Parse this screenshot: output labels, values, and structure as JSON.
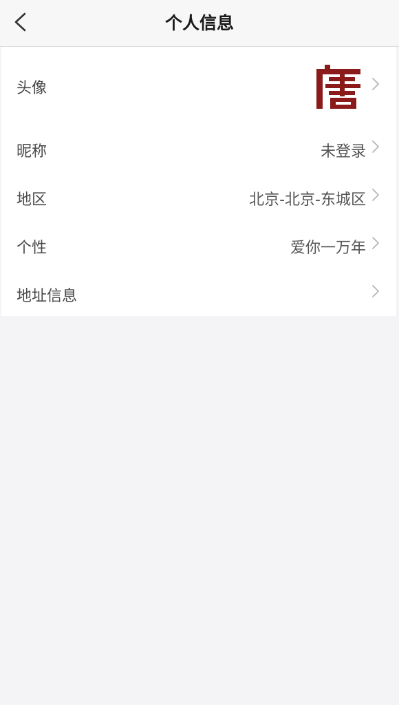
{
  "navbar": {
    "back_icon": "chevron-left-icon",
    "title": "个人信息"
  },
  "rows": [
    {
      "label": "头像",
      "value": "",
      "type": "avatar"
    },
    {
      "label": "昵称",
      "value": "未登录"
    },
    {
      "label": "地区",
      "value": "北京-北京-东城区"
    },
    {
      "label": "个性",
      "value": "爱你一万年"
    },
    {
      "label": "地址信息",
      "value": ""
    }
  ],
  "avatar": {
    "glyph": "唐",
    "color": "#8b1a1a",
    "icon": "avatar-logo"
  },
  "colors": {
    "page_background": "#f4f4f6",
    "navbar_background": "#f7f7f7",
    "list_background": "#ffffff",
    "chevron": "#b5b5b5"
  }
}
